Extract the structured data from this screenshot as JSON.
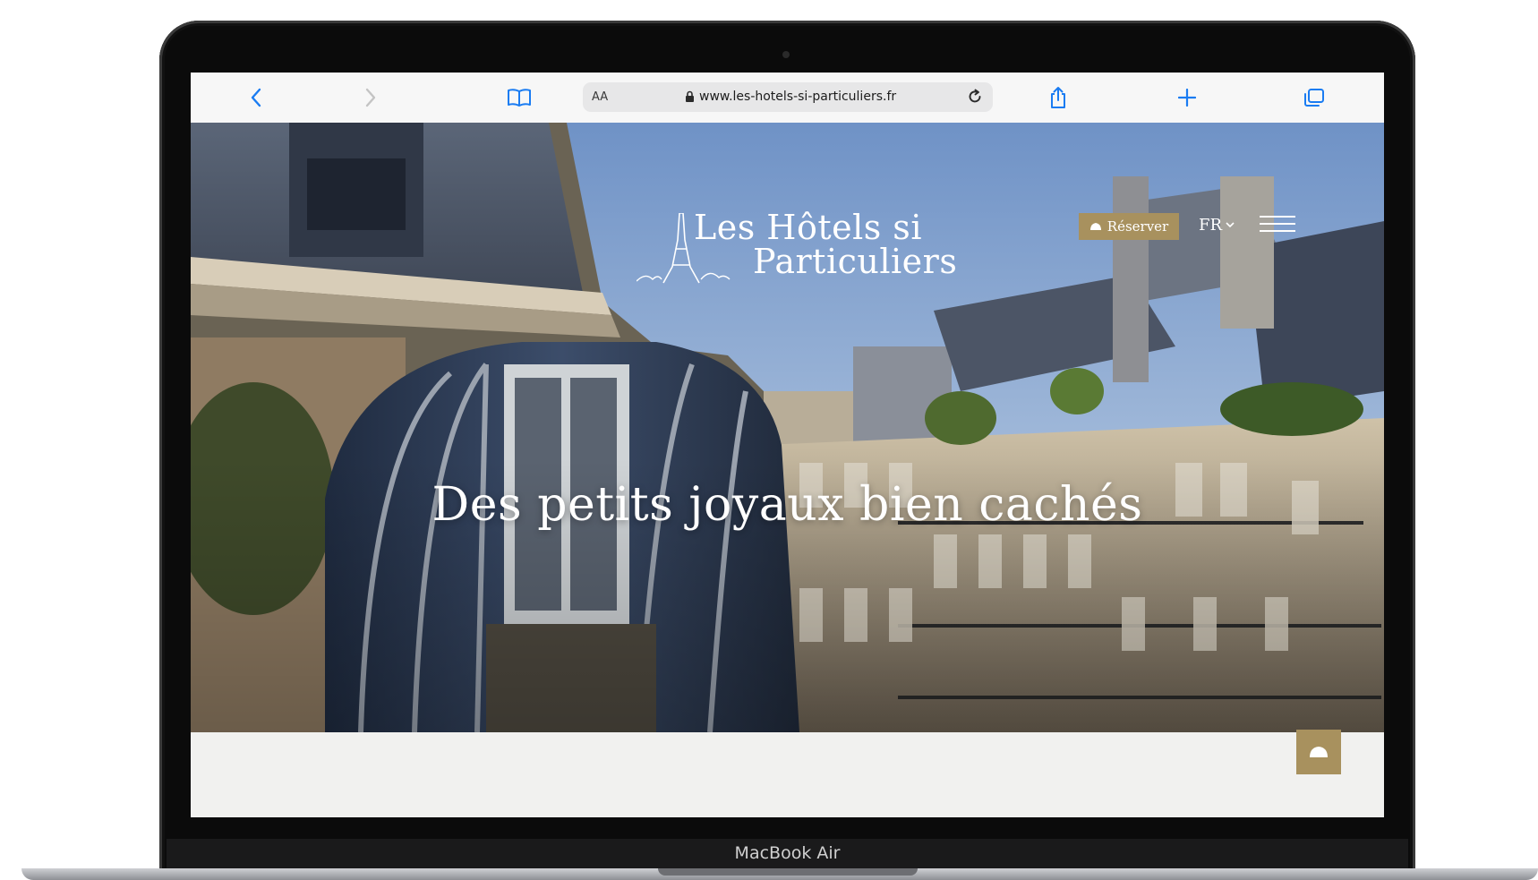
{
  "device": {
    "model_label": "MacBook Air"
  },
  "browser": {
    "text_size_label": "AA",
    "url": "www.les-hotels-si-particuliers.fr",
    "accent": "#1a7cf2",
    "icons": [
      "chevron-left-icon",
      "chevron-right-icon",
      "bookmarks-icon",
      "lock-icon",
      "reload-icon",
      "share-icon",
      "plus-icon",
      "tabs-icon"
    ]
  },
  "site": {
    "logo_line1": "Les Hôtels si",
    "logo_line2": "Particuliers",
    "reserve_label": "Réserver",
    "language": "FR",
    "headline": "Des petits joyaux bien cachés",
    "accent_gold": "#a8915e"
  }
}
